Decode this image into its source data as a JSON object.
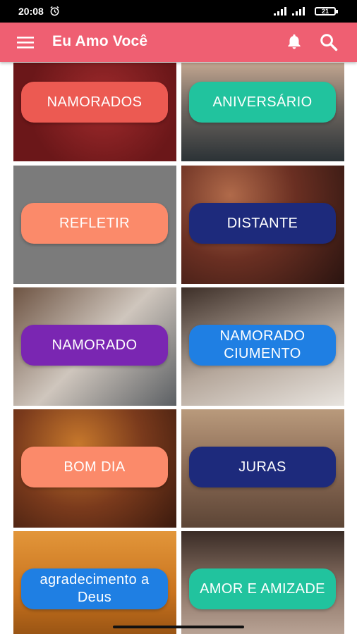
{
  "status_bar": {
    "time": "20:08",
    "battery": "21"
  },
  "app_bar": {
    "title": "Eu Amo Você"
  },
  "categories": [
    {
      "label": "NAMORADOS",
      "pill_color": "#ec5a52",
      "bg_color": "#7d1e21"
    },
    {
      "label": "ANIVERSÁRIO",
      "pill_color": "#21c39e",
      "bg_color": "#3f4a4f"
    },
    {
      "label": "REFLETIR",
      "pill_color": "#fb8a6a",
      "bg_color": "#7b7b7b"
    },
    {
      "label": "DISTANTE",
      "pill_color": "#1d2a7c",
      "bg_color": "#5a2f24"
    },
    {
      "label": "NAMORADO",
      "pill_color": "#7a26b2",
      "bg_color": "#a99a8e"
    },
    {
      "label": "NAMORADO CIUMENTO",
      "pill_color": "#1f7fe3",
      "bg_color": "#8a7a70"
    },
    {
      "label": "BOM DIA",
      "pill_color": "#fb8a6a",
      "bg_color": "#7a3a1c"
    },
    {
      "label": "JURAS",
      "pill_color": "#1d2a7c",
      "bg_color": "#8a6a54"
    },
    {
      "label": "agradecimento a Deus",
      "pill_color": "#1f7fe3",
      "bg_color": "#c9731e"
    },
    {
      "label": "AMOR E AMIZADE",
      "pill_color": "#21c39e",
      "bg_color": "#5b4a40"
    }
  ]
}
